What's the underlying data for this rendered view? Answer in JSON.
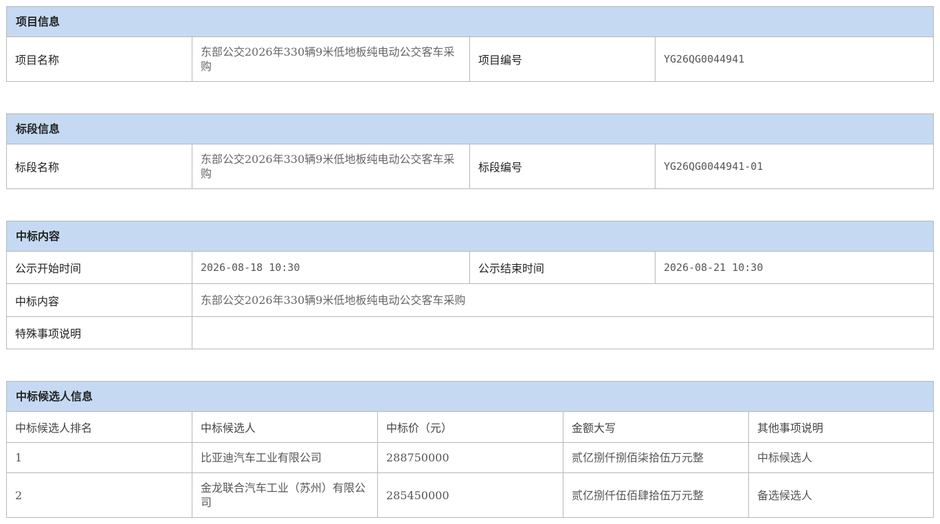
{
  "project_info": {
    "header": "项目信息",
    "name_label": "项目名称",
    "name_value": "东部公交2026年330辆9米低地板纯电动公交客车采购",
    "code_label": "项目编号",
    "code_value": "YG26QG0044941"
  },
  "lot_info": {
    "header": "标段信息",
    "name_label": "标段名称",
    "name_value": "东部公交2026年330辆9米低地板纯电动公交客车采购",
    "code_label": "标段编号",
    "code_value": "YG26QG0044941-01"
  },
  "award_content": {
    "header": "中标内容",
    "start_label": "公示开始时间",
    "start_value": "2026-08-18 10:30",
    "end_label": "公示结束时间",
    "end_value": "2026-08-21 10:30",
    "content_label": "中标内容",
    "content_value": "东部公交2026年330辆9米低地板纯电动公交客车采购",
    "special_label": "特殊事项说明",
    "special_value": ""
  },
  "candidates": {
    "header": "中标候选人信息",
    "columns": [
      "中标候选人排名",
      "中标候选人",
      "中标价（元）",
      "金额大写",
      "其他事项说明"
    ],
    "rows": [
      {
        "rank": "1",
        "name": "比亚迪汽车工业有限公司",
        "price": "288750000",
        "amount_words": "贰亿捌仟捌佰柒拾伍万元整",
        "note": "中标候选人"
      },
      {
        "rank": "2",
        "name": "金龙联合汽车工业（苏州）有限公司",
        "price": "285450000",
        "amount_words": "贰亿捌仟伍佰肆拾伍万元整",
        "note": "备选候选人"
      }
    ]
  }
}
